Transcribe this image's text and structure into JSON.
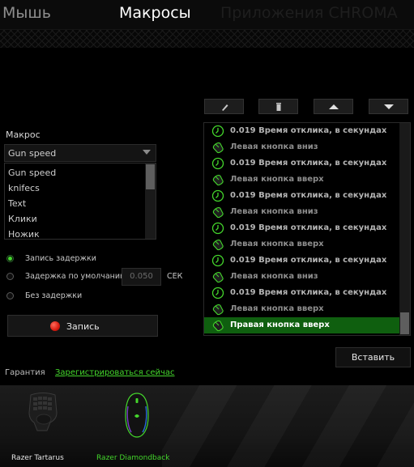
{
  "tabs": {
    "mouse": "Мышь",
    "macros": "Макросы",
    "apps": "Приложения CHROMA"
  },
  "macro_panel": {
    "label": "Макрос",
    "selected": "Gun speed",
    "items": [
      "Gun speed",
      "knifecs",
      "Text",
      "Клики",
      "Ножик"
    ]
  },
  "recording": {
    "options": [
      {
        "label": "Запись задержки",
        "checked": true
      },
      {
        "label": "Задержка по умолчанию",
        "checked": false
      },
      {
        "label": "Без задержки",
        "checked": false
      }
    ],
    "default_delay": "0.050",
    "unit": "СЕК",
    "record_button": "Запись"
  },
  "toolbar": {
    "edit_icon": "pencil-icon",
    "delete_icon": "trash-icon",
    "up_icon": "arrow-up-icon",
    "down_icon": "arrow-down-icon"
  },
  "sequence": [
    {
      "icon": "clock-icon",
      "text": "0.019 Время отклика, в секундах",
      "selected": false
    },
    {
      "icon": "mouse-icon",
      "text": "Левая кнопка вниз",
      "selected": false
    },
    {
      "icon": "clock-icon",
      "text": "0.019 Время отклика, в секундах",
      "selected": false
    },
    {
      "icon": "mouse-icon",
      "text": "Левая кнопка вверх",
      "selected": false
    },
    {
      "icon": "clock-icon",
      "text": "0.019 Время отклика, в секундах",
      "selected": false
    },
    {
      "icon": "mouse-icon",
      "text": "Левая кнопка вниз",
      "selected": false
    },
    {
      "icon": "clock-icon",
      "text": "0.019 Время отклика, в секундах",
      "selected": false
    },
    {
      "icon": "mouse-icon",
      "text": "Левая кнопка вверх",
      "selected": false
    },
    {
      "icon": "clock-icon",
      "text": "0.019 Время отклика, в секундах",
      "selected": false
    },
    {
      "icon": "mouse-icon",
      "text": "Левая кнопка вниз",
      "selected": false
    },
    {
      "icon": "clock-icon",
      "text": "0.019 Время отклика, в секундах",
      "selected": false
    },
    {
      "icon": "mouse-icon",
      "text": "Левая кнопка вверх",
      "selected": false
    },
    {
      "icon": "mouse-icon",
      "text": "Правая кнопка вверх",
      "selected": true
    }
  ],
  "insert_button": "Вставить",
  "footer": {
    "warranty": "Гарантия",
    "register": "Зарегистрироваться сейчас"
  },
  "devices": [
    {
      "name": "Razer Tartarus",
      "active": false
    },
    {
      "name": "Razer Diamondback",
      "active": true
    }
  ],
  "colors": {
    "accent": "#44d62c",
    "selected_row": "#0f5f0f",
    "record": "#d81c10"
  }
}
